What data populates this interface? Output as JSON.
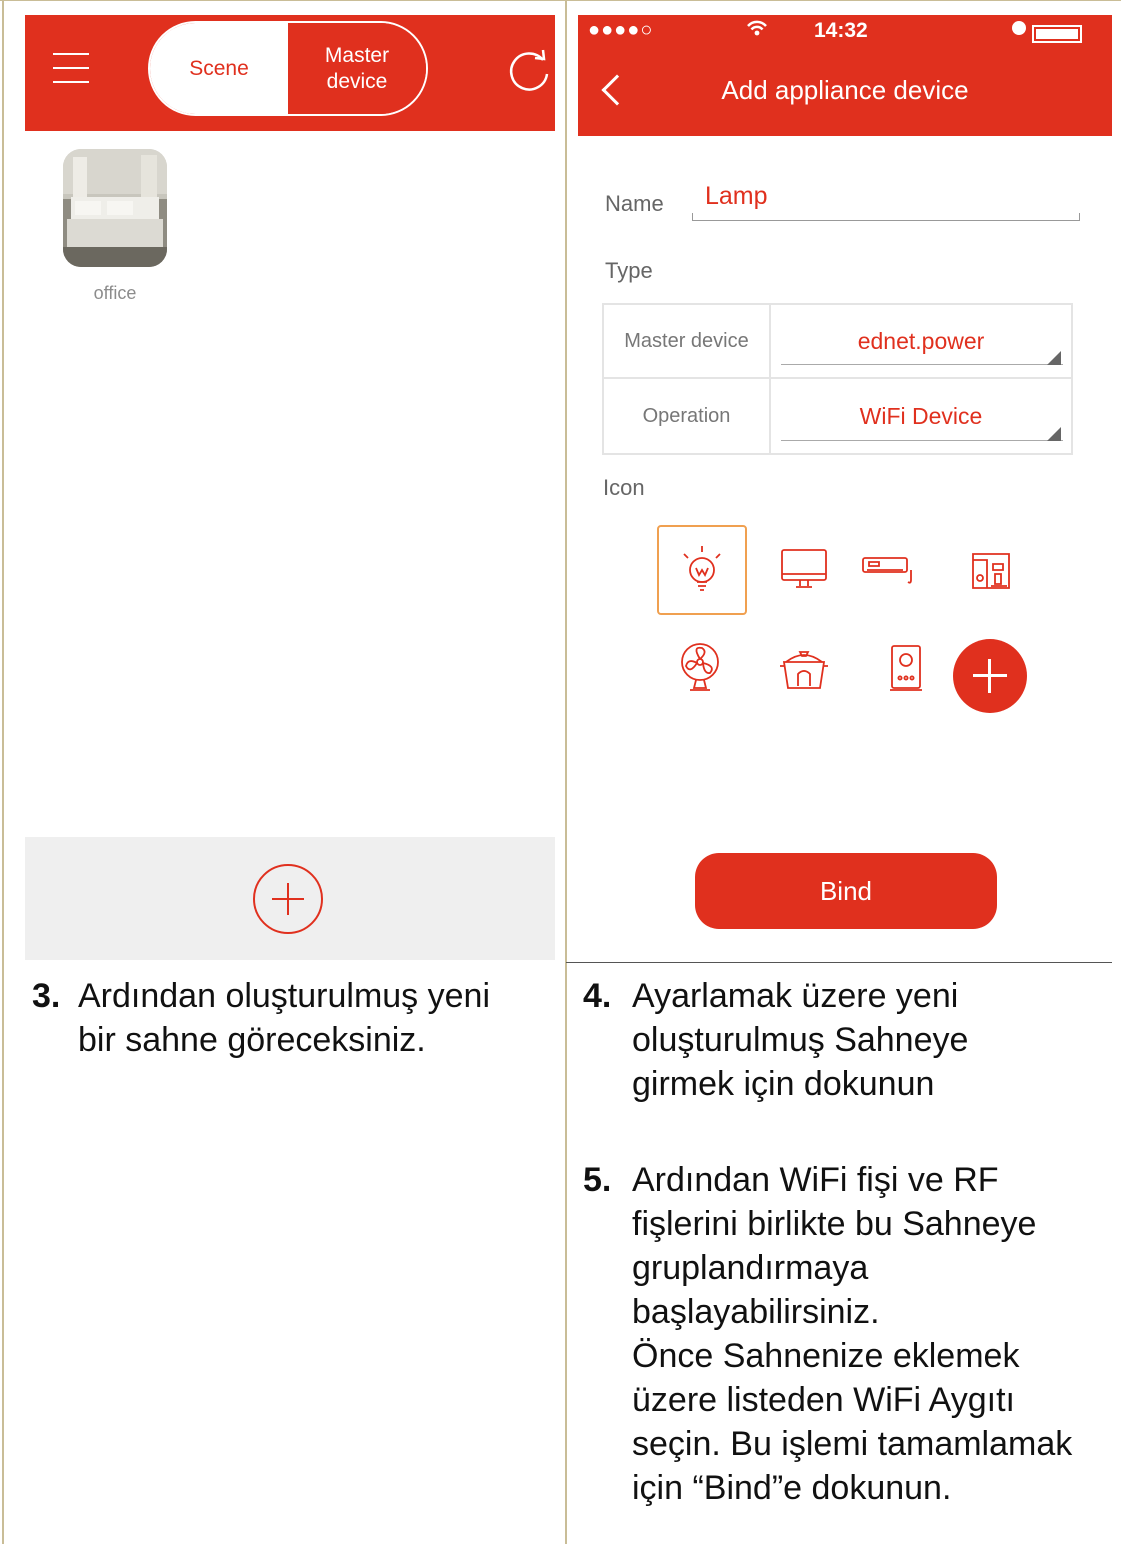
{
  "left_app": {
    "tabs": {
      "scene": "Scene",
      "master": "Master\ndevice"
    },
    "scene_label": "office"
  },
  "right_app": {
    "status": {
      "signal": "●●●●○",
      "wifi": "ᯤ",
      "time": "14:32"
    },
    "title": "Add appliance device",
    "name_label": "Name",
    "name_value": "Lamp",
    "type_label": "Type",
    "type_rows": [
      {
        "key": "Master device",
        "value": "ednet.power"
      },
      {
        "key": "Operation",
        "value": "WiFi Device"
      }
    ],
    "icon_label": "Icon",
    "icons": [
      "lamp-icon",
      "monitor-icon",
      "air-conditioner-icon",
      "coffee-machine-icon",
      "fan-icon",
      "rice-cooker-icon",
      "speaker-icon",
      "add-icon"
    ],
    "bind_label": "Bind"
  },
  "captions": {
    "step3_num": "3.",
    "step3_lines": [
      "Ardından oluşturulmuş yeni",
      "bir sahne göreceksiniz."
    ],
    "step4_num": "4.",
    "step4_lines": [
      "Ayarlamak üzere yeni",
      "oluşturulmuş Sahneye",
      "girmek için dokunun"
    ],
    "step5_num": "5.",
    "step5_lines": [
      "Ardından WiFi fişi ve RF",
      "fişlerini birlikte bu Sahneye",
      "gruplandırmaya",
      "başlayabilirsiniz.",
      "Önce Sahnenize eklemek",
      "üzere listeden WiFi Aygıtı",
      "seçin. Bu işlemi tamamlamak",
      "için “Bind”e dokunun."
    ]
  },
  "colors": {
    "brand": "#e0301e",
    "frame": "#c9bd97",
    "selected_border": "#f0a050"
  }
}
